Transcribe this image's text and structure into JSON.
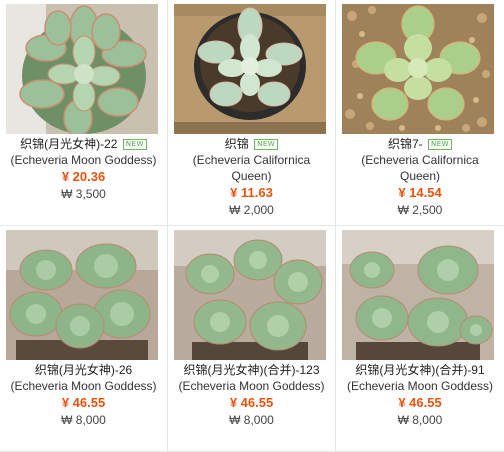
{
  "products": [
    {
      "name": "织锦(月光女神)-22",
      "badge": "NEW",
      "subtitle_1": "(Echeveria Moon Goddess)",
      "subtitle_2": "",
      "price_cny": "¥ 20.36",
      "price_krw": "₩ 3,500",
      "image_icon": "succulent-rosette-photo"
    },
    {
      "name": "织锦",
      "badge": "NEW",
      "subtitle_1": "(Echeveria Californica",
      "subtitle_2": "Queen)",
      "price_cny": "¥ 11.63",
      "price_krw": "₩ 2,000",
      "image_icon": "succulent-pot-photo"
    },
    {
      "name": "织锦7-",
      "badge": "NEW",
      "subtitle_1": "(Echeveria Californica",
      "subtitle_2": "Queen)",
      "price_cny": "¥ 14.54",
      "price_krw": "₩ 2,500",
      "image_icon": "succulent-gravel-photo"
    },
    {
      "name": "织锦(月光女神)-26",
      "badge": "",
      "subtitle_1": "(Echeveria Moon Goddess)",
      "subtitle_2": "",
      "price_cny": "¥ 46.55",
      "price_krw": "₩ 8,000",
      "image_icon": "succulent-cluster-photo"
    },
    {
      "name": "织锦(月光女神)(合并)-123",
      "badge": "",
      "subtitle_1": "(Echeveria Moon Goddess)",
      "subtitle_2": "",
      "price_cny": "¥ 46.55",
      "price_krw": "₩ 8,000",
      "image_icon": "succulent-cluster-photo"
    },
    {
      "name": "织锦(月光女神)(合并)-91",
      "badge": "",
      "subtitle_1": "(Echeveria Moon Goddess)",
      "subtitle_2": "",
      "price_cny": "¥ 46.55",
      "price_krw": "₩ 8,000",
      "image_icon": "succulent-cluster-photo"
    }
  ],
  "colors": {
    "price": "#e8530e",
    "badge": "#4aa83a",
    "leaf": "#8fb58c",
    "leaf_tip": "#c47a5a"
  }
}
